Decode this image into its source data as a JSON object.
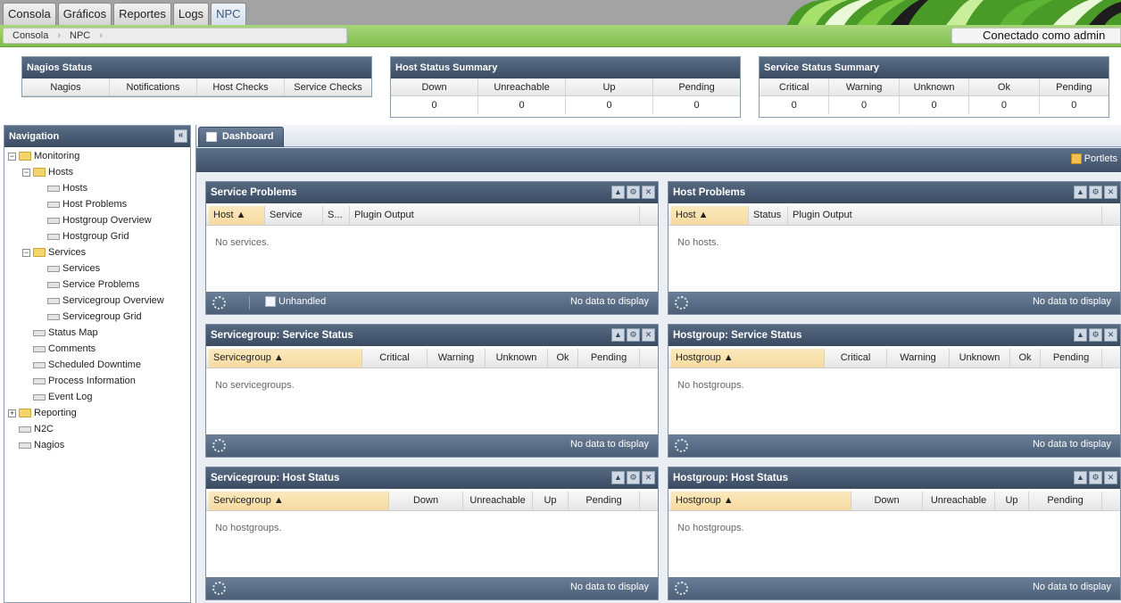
{
  "top_tabs": [
    "Consola",
    "Gráficos",
    "Reportes",
    "Logs",
    "NPC"
  ],
  "breadcrumb": [
    "Consola",
    "NPC"
  ],
  "user_status": "Conectado como admin",
  "nagios_status": {
    "title": "Nagios Status",
    "columns": [
      "Nagios",
      "Notifications",
      "Host Checks",
      "Service Checks"
    ]
  },
  "host_status_summary": {
    "title": "Host Status Summary",
    "columns": [
      "Down",
      "Unreachable",
      "Up",
      "Pending"
    ],
    "values": [
      "0",
      "0",
      "0",
      "0"
    ]
  },
  "service_status_summary": {
    "title": "Service Status Summary",
    "columns": [
      "Critical",
      "Warning",
      "Unknown",
      "Ok",
      "Pending"
    ],
    "values": [
      "0",
      "0",
      "0",
      "0",
      "0"
    ]
  },
  "navigation": {
    "title": "Navigation",
    "items": [
      "Monitoring",
      "Hosts",
      "Hosts",
      "Host Problems",
      "Hostgroup Overview",
      "Hostgroup Grid",
      "Services",
      "Services",
      "Service Problems",
      "Servicegroup Overview",
      "Servicegroup Grid",
      "Status Map",
      "Comments",
      "Scheduled Downtime",
      "Process Information",
      "Event Log",
      "Reporting",
      "N2C",
      "Nagios"
    ]
  },
  "dashboard": {
    "tab_label": "Dashboard",
    "portlets_label": "Portlets"
  },
  "portlets": {
    "service_problems": {
      "title": "Service Problems",
      "columns": [
        "Host ▲",
        "Service",
        "S...",
        "Plugin Output"
      ],
      "empty": "No services.",
      "filter": "Unhandled",
      "footer": "No data to display"
    },
    "host_problems": {
      "title": "Host Problems",
      "columns": [
        "Host ▲",
        "Status",
        "Plugin Output"
      ],
      "empty": "No hosts.",
      "footer": "No data to display"
    },
    "sg_service_status": {
      "title": "Servicegroup: Service Status",
      "columns": [
        "Servicegroup ▲",
        "Critical",
        "Warning",
        "Unknown",
        "Ok",
        "Pending"
      ],
      "empty": "No servicegroups.",
      "footer": "No data to display"
    },
    "hg_service_status": {
      "title": "Hostgroup: Service Status",
      "columns": [
        "Hostgroup ▲",
        "Critical",
        "Warning",
        "Unknown",
        "Ok",
        "Pending"
      ],
      "empty": "No hostgroups.",
      "footer": "No data to display"
    },
    "sg_host_status": {
      "title": "Servicegroup: Host Status",
      "columns": [
        "Servicegroup ▲",
        "Down",
        "Unreachable",
        "Up",
        "Pending"
      ],
      "empty": "No hostgroups.",
      "footer": "No data to display"
    },
    "hg_host_status": {
      "title": "Hostgroup: Host Status",
      "columns": [
        "Hostgroup ▲",
        "Down",
        "Unreachable",
        "Up",
        "Pending"
      ],
      "empty": "No hostgroups.",
      "footer": "No data to display"
    }
  },
  "colors": {
    "header_dark": "#3b4c62",
    "green_bar": "#8cc55a",
    "sorted_col": "#f6dba0"
  }
}
